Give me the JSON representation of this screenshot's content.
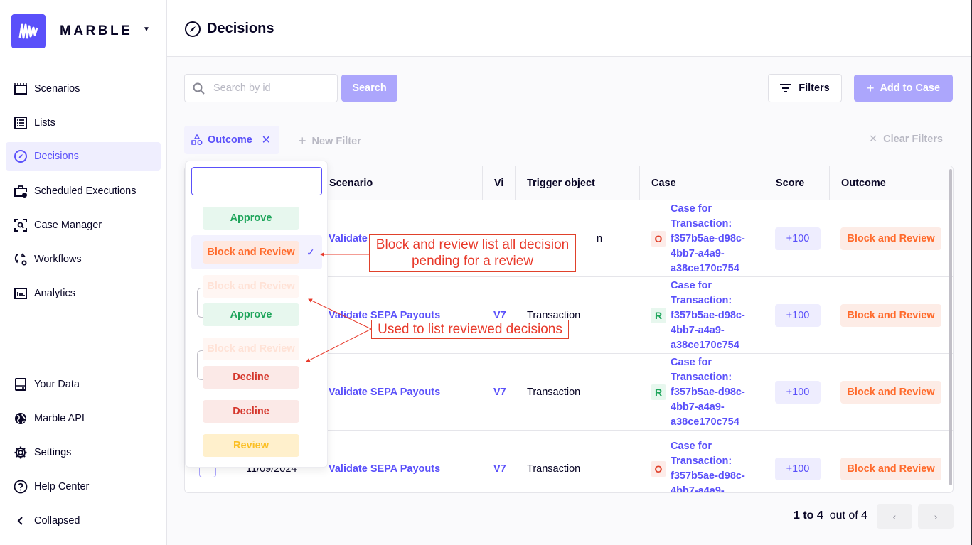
{
  "brand": {
    "name": "MARBLE",
    "accent": "#5a50fa"
  },
  "sidebar": {
    "items": [
      {
        "label": "Scenarios",
        "icon": "clapperboard-icon",
        "active": false
      },
      {
        "label": "Lists",
        "icon": "list-icon",
        "active": false
      },
      {
        "label": "Decisions",
        "icon": "compass-icon",
        "active": true
      },
      {
        "label": "Scheduled Executions",
        "icon": "scheduled-icon",
        "active": false
      },
      {
        "label": "Case Manager",
        "icon": "case-search-icon",
        "active": false
      },
      {
        "label": "Workflows",
        "icon": "workflow-icon",
        "active": false
      },
      {
        "label": "Analytics",
        "icon": "analytics-icon",
        "active": false
      }
    ],
    "bottom_items": [
      {
        "label": "Your Data",
        "icon": "harddrive-icon"
      },
      {
        "label": "Marble API",
        "icon": "globe-icon"
      },
      {
        "label": "Settings",
        "icon": "gear-icon"
      },
      {
        "label": "Help Center",
        "icon": "help-icon"
      },
      {
        "label": "Collapsed",
        "icon": "chevron-left-icon"
      }
    ]
  },
  "header": {
    "title": "Decisions"
  },
  "toolbar": {
    "search_placeholder": "Search by id",
    "search_value": "",
    "search_label": "Search",
    "filters_label": "Filters",
    "add_to_case_label": "Add to Case",
    "clear_filters_label": "Clear Filters",
    "new_filter_label": "New Filter"
  },
  "active_filter": {
    "label": "Outcome"
  },
  "dropdown": {
    "search_value": "",
    "options": [
      {
        "label": "Approve",
        "kind": "approve",
        "selected": false
      },
      {
        "label": "Block and Review",
        "kind": "block",
        "selected": true
      },
      {
        "label": "Block and Review",
        "kind": "block-faded",
        "review_from": true
      },
      {
        "label": "Approve",
        "kind": "approve",
        "review_to": true
      },
      {
        "label": "Block and Review",
        "kind": "block-faded",
        "review_from": true
      },
      {
        "label": "Decline",
        "kind": "decline",
        "review_to": true
      },
      {
        "label": "Decline",
        "kind": "decline",
        "selected": false
      },
      {
        "label": "Review",
        "kind": "review",
        "selected": false
      }
    ]
  },
  "table": {
    "columns": [
      "Scenario",
      "Vi",
      "Trigger object",
      "Case",
      "Score",
      "Outcome"
    ],
    "rows": [
      {
        "date": "",
        "scenario": "Validate",
        "version": "",
        "trigger": "n",
        "case_status": "O",
        "case_title": "Case for Transaction: f357b5ae-d98c-4bb7-a4a9-a38ce170c754",
        "score": "+100",
        "outcome": "Block and Review"
      },
      {
        "date": "",
        "scenario": "Validate SEPA Payouts",
        "version": "V7",
        "trigger": "Transaction",
        "case_status": "R",
        "case_title": "Case for Transaction: f357b5ae-d98c-4bb7-a4a9-a38ce170c754",
        "score": "+100",
        "outcome": "Block and Review"
      },
      {
        "date": "",
        "scenario": "Validate SEPA Payouts",
        "version": "V7",
        "trigger": "Transaction",
        "case_status": "R",
        "case_title": "Case for Transaction: f357b5ae-d98c-4bb7-a4a9-a38ce170c754",
        "score": "+100",
        "outcome": "Block and Review"
      },
      {
        "date": "11/09/2024",
        "scenario": "Validate SEPA Payouts",
        "version": "V7",
        "trigger": "Transaction",
        "case_status": "O",
        "case_title": "Case for Transaction: f357b5ae-d98c-4bb7-a4a9-",
        "score": "+100",
        "outcome": "Block and Review"
      }
    ]
  },
  "pagination": {
    "range": "1 to 4",
    "total_text": "out of 4"
  },
  "annotations": {
    "pending": "Block and review list all decision pending for a review",
    "reviewed": "Used to list reviewed decisions"
  }
}
